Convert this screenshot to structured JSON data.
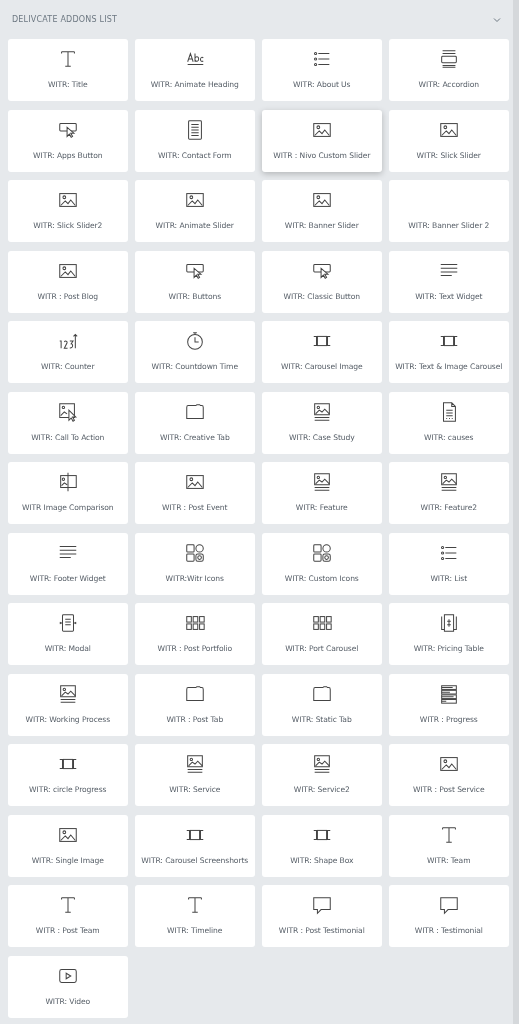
{
  "section": {
    "title": "DELIVCATE ADDONS LIST",
    "expanded": true
  },
  "widgets": [
    {
      "label": "WITR: Title",
      "kind": "title",
      "selected": false
    },
    {
      "label": "WITR: Animate Heading",
      "kind": "abc",
      "selected": false
    },
    {
      "label": "WITR: About Us",
      "kind": "list",
      "selected": false
    },
    {
      "label": "WITR: Accordion",
      "kind": "accordion",
      "selected": false
    },
    {
      "label": "WITR: Apps Button",
      "kind": "button",
      "selected": false
    },
    {
      "label": "WITR: Contact Form",
      "kind": "form",
      "selected": false
    },
    {
      "label": "WITR : Nivo Custom Slider",
      "kind": "image",
      "selected": true
    },
    {
      "label": "WITR: Slick Slider",
      "kind": "image",
      "selected": false
    },
    {
      "label": "WITR: Slick Slider2",
      "kind": "image",
      "selected": false
    },
    {
      "label": "WITR: Animate Slider",
      "kind": "image",
      "selected": false
    },
    {
      "label": "WITR: Banner Slider",
      "kind": "image",
      "selected": false
    },
    {
      "label": "WITR: Banner Slider 2",
      "kind": "plain",
      "selected": false
    },
    {
      "label": "WITR : Post Blog",
      "kind": "image",
      "selected": false
    },
    {
      "label": "WITR: Buttons",
      "kind": "button",
      "selected": false
    },
    {
      "label": "WITR: Classic Button",
      "kind": "button",
      "selected": false
    },
    {
      "label": "WITR: Text Widget",
      "kind": "text",
      "selected": false
    },
    {
      "label": "WITR: Counter",
      "kind": "counter",
      "selected": false
    },
    {
      "label": "WITR: Countdown Time",
      "kind": "timer",
      "selected": false
    },
    {
      "label": "WITR: Carousel Image",
      "kind": "carousel",
      "selected": false
    },
    {
      "label": "WITR: Text & Image Carousel",
      "kind": "carousel",
      "selected": false
    },
    {
      "label": "WITR: Call To Action",
      "kind": "cta",
      "selected": false
    },
    {
      "label": "WITR: Creative Tab",
      "kind": "tab",
      "selected": false
    },
    {
      "label": "WITR: Case Study",
      "kind": "feature",
      "selected": false
    },
    {
      "label": "WITR: causes",
      "kind": "doc",
      "selected": false
    },
    {
      "label": "WITR Image Comparison",
      "kind": "compare",
      "selected": false
    },
    {
      "label": "WITR : Post Event",
      "kind": "image",
      "selected": false
    },
    {
      "label": "WITR: Feature",
      "kind": "feature",
      "selected": false
    },
    {
      "label": "WITR: Feature2",
      "kind": "feature",
      "selected": false
    },
    {
      "label": "WITR: Footer Widget",
      "kind": "text",
      "selected": false
    },
    {
      "label": "WITR:Witr Icons",
      "kind": "social",
      "selected": false
    },
    {
      "label": "WITR: Custom Icons",
      "kind": "social",
      "selected": false
    },
    {
      "label": "WITR: List",
      "kind": "list",
      "selected": false
    },
    {
      "label": "WITR: Modal",
      "kind": "modal",
      "selected": false
    },
    {
      "label": "WITR : Post Portfolio",
      "kind": "grid",
      "selected": false
    },
    {
      "label": "WITR: Port Carousel",
      "kind": "grid",
      "selected": false
    },
    {
      "label": "WITR: Pricing Table",
      "kind": "pricing",
      "selected": false
    },
    {
      "label": "WITR: Working Process",
      "kind": "feature",
      "selected": false
    },
    {
      "label": "WITR : Post Tab",
      "kind": "tab",
      "selected": false
    },
    {
      "label": "WITR: Static Tab",
      "kind": "tab",
      "selected": false
    },
    {
      "label": "WITR : Progress",
      "kind": "progress",
      "selected": false
    },
    {
      "label": "WITR: circle Progress",
      "kind": "carousel",
      "selected": false
    },
    {
      "label": "WITR: Service",
      "kind": "feature",
      "selected": false
    },
    {
      "label": "WITR: Service2",
      "kind": "feature",
      "selected": false
    },
    {
      "label": "WITR : Post Service",
      "kind": "image",
      "selected": false
    },
    {
      "label": "WITR: Single Image",
      "kind": "image",
      "selected": false
    },
    {
      "label": "WITR: Carousel Screenshorts",
      "kind": "carousel",
      "selected": false
    },
    {
      "label": "WITR: Shape Box",
      "kind": "carousel",
      "selected": false
    },
    {
      "label": "WITR: Team",
      "kind": "title",
      "selected": false
    },
    {
      "label": "WITR : Post Team",
      "kind": "title",
      "selected": false
    },
    {
      "label": "WITR: Timeline",
      "kind": "title",
      "selected": false
    },
    {
      "label": "WITR : Post Testimonial",
      "kind": "comment",
      "selected": false
    },
    {
      "label": "WITR : Testimonial",
      "kind": "comment",
      "selected": false
    },
    {
      "label": "WITR: Video",
      "kind": "video",
      "selected": false
    }
  ]
}
